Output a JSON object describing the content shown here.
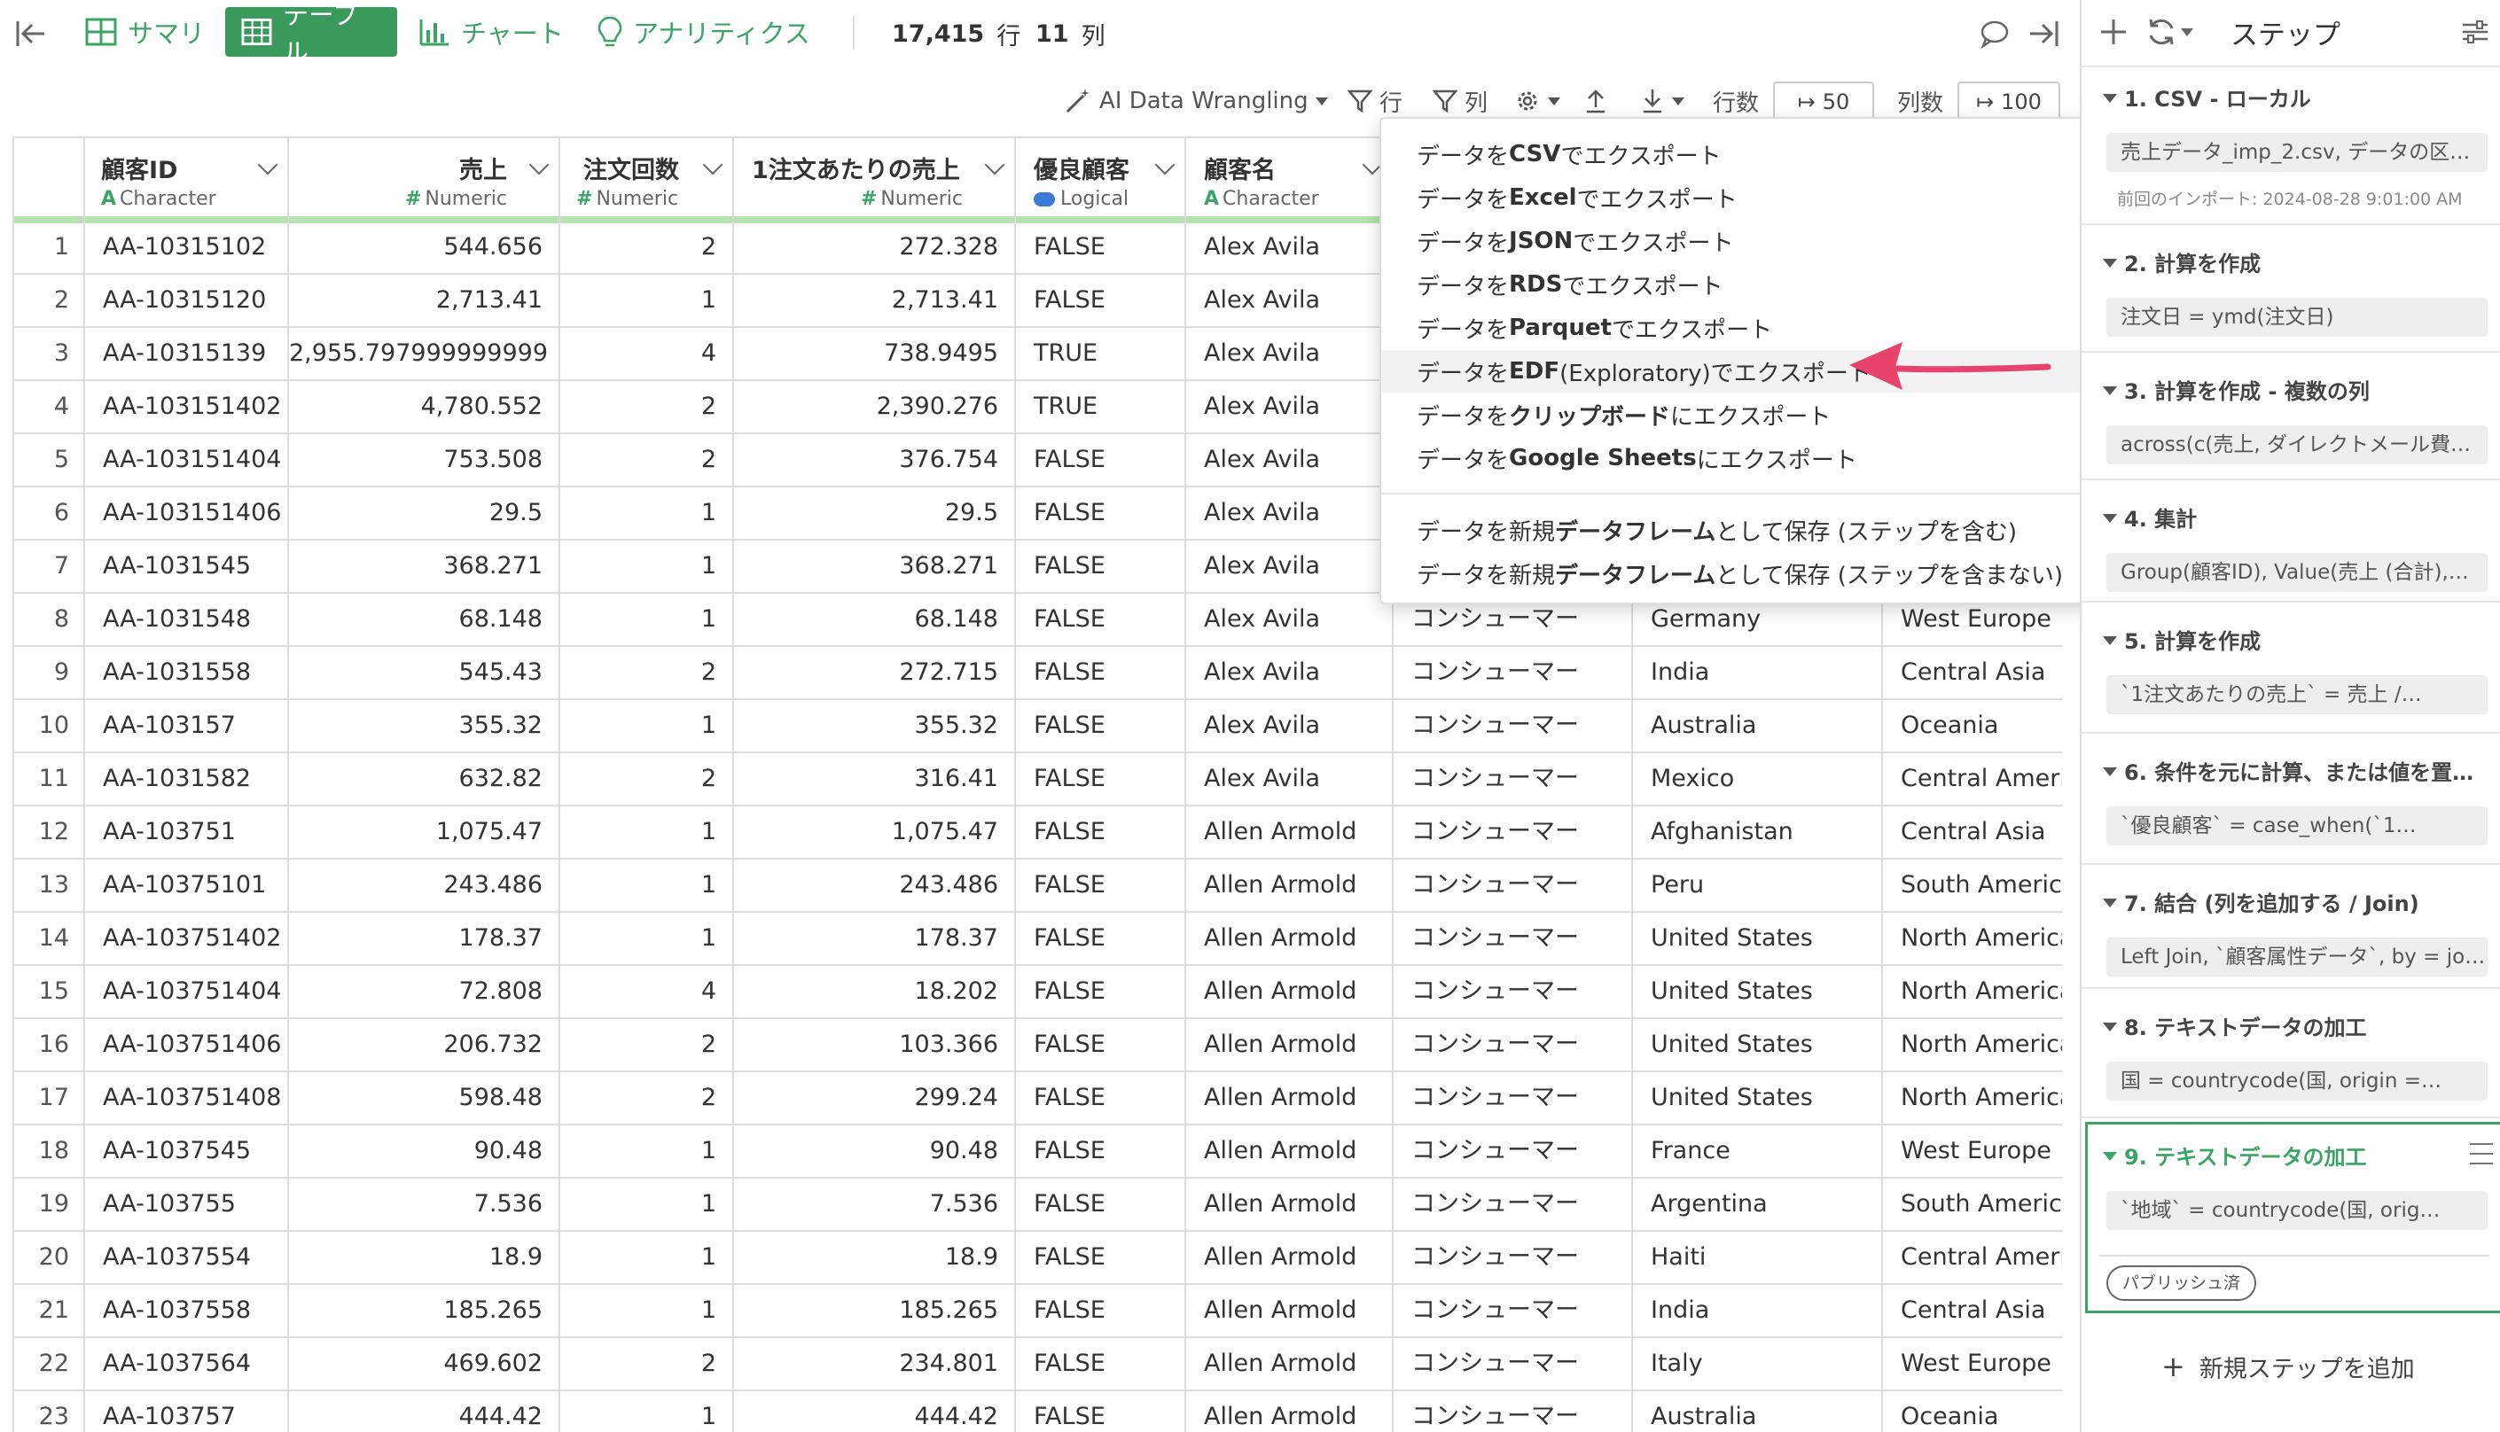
{
  "topbar": {
    "tabs": [
      {
        "label": "サマリ",
        "icon": "summary-grid-icon"
      },
      {
        "label": "テーブル",
        "icon": "table-icon"
      },
      {
        "label": "チャート",
        "icon": "bar-chart-icon"
      },
      {
        "label": "アナリティクス",
        "icon": "bulb-icon"
      }
    ],
    "rows_count": "17,415",
    "rows_unit": "行",
    "cols_count": "11",
    "cols_unit": "列"
  },
  "toolbar": {
    "ai_label": "AI Data Wrangling",
    "filter_rows": "行",
    "filter_cols": "列",
    "rows_label": "行数",
    "rows_value": "50",
    "cols_label": "列数",
    "cols_value": "100"
  },
  "colors": {
    "accent": "#3a9a5c",
    "header_underline": "#b7e3b0",
    "arrow": "#e8436a",
    "step_active_border": "#3aa565"
  },
  "columns": [
    {
      "name": "顧客ID",
      "type": "Character",
      "type_icon": "A"
    },
    {
      "name": "売上",
      "type": "Numeric",
      "type_icon": "#"
    },
    {
      "name": "注文回数",
      "type": "Numeric",
      "type_icon": "#"
    },
    {
      "name": "1注文あたりの売上",
      "type": "Numeric",
      "type_icon": "#"
    },
    {
      "name": "優良顧客",
      "type": "Logical",
      "type_icon": "toggle"
    },
    {
      "name": "顧客名",
      "type": "Character",
      "type_icon": "A"
    }
  ],
  "rows": [
    [
      "1",
      "AA-10315102",
      "544.656",
      "2",
      "272.328",
      "FALSE",
      "Alex Avila",
      "",
      ""
    ],
    [
      "2",
      "AA-10315120",
      "2,713.41",
      "1",
      "2,713.41",
      "FALSE",
      "Alex Avila",
      "",
      ""
    ],
    [
      "3",
      "AA-10315139",
      "2,955.797999999999",
      "4",
      "738.9495",
      "TRUE",
      "Alex Avila",
      "",
      ""
    ],
    [
      "4",
      "AA-103151402",
      "4,780.552",
      "2",
      "2,390.276",
      "TRUE",
      "Alex Avila",
      "",
      ""
    ],
    [
      "5",
      "AA-103151404",
      "753.508",
      "2",
      "376.754",
      "FALSE",
      "Alex Avila",
      "",
      ""
    ],
    [
      "6",
      "AA-103151406",
      "29.5",
      "1",
      "29.5",
      "FALSE",
      "Alex Avila",
      "",
      ""
    ],
    [
      "7",
      "AA-1031545",
      "368.271",
      "1",
      "368.271",
      "FALSE",
      "Alex Avila",
      "",
      ""
    ],
    [
      "8",
      "AA-1031548",
      "68.148",
      "1",
      "68.148",
      "FALSE",
      "Alex Avila",
      "コンシューマー",
      "Germany",
      "West Europe"
    ],
    [
      "9",
      "AA-1031558",
      "545.43",
      "2",
      "272.715",
      "FALSE",
      "Alex Avila",
      "コンシューマー",
      "India",
      "Central Asia"
    ],
    [
      "10",
      "AA-103157",
      "355.32",
      "1",
      "355.32",
      "FALSE",
      "Alex Avila",
      "コンシューマー",
      "Australia",
      "Oceania"
    ],
    [
      "11",
      "AA-1031582",
      "632.82",
      "2",
      "316.41",
      "FALSE",
      "Alex Avila",
      "コンシューマー",
      "Mexico",
      "Central Americ"
    ],
    [
      "12",
      "AA-103751",
      "1,075.47",
      "1",
      "1,075.47",
      "FALSE",
      "Allen Armold",
      "コンシューマー",
      "Afghanistan",
      "Central Asia"
    ],
    [
      "13",
      "AA-10375101",
      "243.486",
      "1",
      "243.486",
      "FALSE",
      "Allen Armold",
      "コンシューマー",
      "Peru",
      "South America"
    ],
    [
      "14",
      "AA-103751402",
      "178.37",
      "1",
      "178.37",
      "FALSE",
      "Allen Armold",
      "コンシューマー",
      "United States",
      "North America"
    ],
    [
      "15",
      "AA-103751404",
      "72.808",
      "4",
      "18.202",
      "FALSE",
      "Allen Armold",
      "コンシューマー",
      "United States",
      "North America"
    ],
    [
      "16",
      "AA-103751406",
      "206.732",
      "2",
      "103.366",
      "FALSE",
      "Allen Armold",
      "コンシューマー",
      "United States",
      "North America"
    ],
    [
      "17",
      "AA-103751408",
      "598.48",
      "2",
      "299.24",
      "FALSE",
      "Allen Armold",
      "コンシューマー",
      "United States",
      "North America"
    ],
    [
      "18",
      "AA-1037545",
      "90.48",
      "1",
      "90.48",
      "FALSE",
      "Allen Armold",
      "コンシューマー",
      "France",
      "West Europe"
    ],
    [
      "19",
      "AA-103755",
      "7.536",
      "1",
      "7.536",
      "FALSE",
      "Allen Armold",
      "コンシューマー",
      "Argentina",
      "South America"
    ],
    [
      "20",
      "AA-1037554",
      "18.9",
      "1",
      "18.9",
      "FALSE",
      "Allen Armold",
      "コンシューマー",
      "Haiti",
      "Central Americ"
    ],
    [
      "21",
      "AA-1037558",
      "185.265",
      "1",
      "185.265",
      "FALSE",
      "Allen Armold",
      "コンシューマー",
      "India",
      "Central Asia"
    ],
    [
      "22",
      "AA-1037564",
      "469.602",
      "2",
      "234.801",
      "FALSE",
      "Allen Armold",
      "コンシューマー",
      "Italy",
      "West Europe"
    ],
    [
      "23",
      "AA-103757",
      "444.42",
      "1",
      "444.42",
      "FALSE",
      "Allen Armold",
      "コンシューマー",
      "Australia",
      "Oceania"
    ]
  ],
  "menu": {
    "items": [
      {
        "pre": "データを",
        "bold": "CSV",
        "post": "でエクスポート"
      },
      {
        "pre": "データを",
        "bold": "Excel",
        "post": "でエクスポート"
      },
      {
        "pre": "データを",
        "bold": "JSON",
        "post": "でエクスポート"
      },
      {
        "pre": "データを",
        "bold": "RDS",
        "post": "でエクスポート"
      },
      {
        "pre": "データを",
        "bold": "Parquet",
        "post": "でエクスポート"
      },
      {
        "pre": "データを",
        "bold": "EDF",
        "post": " (Exploratory)でエクスポート"
      },
      {
        "pre": "データを",
        "bold": "クリップボード",
        "post": "にエクスポート"
      },
      {
        "pre": "データを",
        "bold": "Google Sheets",
        "post": "にエクスポート"
      }
    ],
    "save_items": [
      {
        "pre": "データを新規",
        "bold": "データフレーム",
        "post": "として保存 (ステップを含む)"
      },
      {
        "pre": "データを新規",
        "bold": "データフレーム",
        "post": "として保存 (ステップを含まない)"
      }
    ]
  },
  "panel": {
    "title": "ステップ",
    "steps": [
      {
        "title": "1. CSV - ローカル",
        "box": "売上データ_imp_2.csv, データの区…",
        "note": "前回のインポート: 2024-08-28 9:01:00 AM"
      },
      {
        "title": "2. 計算を作成",
        "box": "注文日 = ymd(注文日)"
      },
      {
        "title": "3. 計算を作成 - 複数の列",
        "box": "across(c(売上, ダイレクトメール費…"
      },
      {
        "title": "4. 集計",
        "box": "Group(顧客ID), Value(売上 (合計),注…"
      },
      {
        "title": "5. 計算を作成",
        "box": "`1注文あたりの売上` = 売上 /…"
      },
      {
        "title": "6. 条件を元に計算、または値を置…",
        "box": "`優良顧客` = case_when(`1…"
      },
      {
        "title": "7. 結合 (列を追加する / Join)",
        "box": "Left Join, `顧客属性データ`, by = joi…"
      },
      {
        "title": "8. テキストデータの加工",
        "box": "国 = countrycode(国, origin =…"
      },
      {
        "title": "9. テキストデータの加工",
        "box": "`地域` = countrycode(国, orig…",
        "badge": "パブリッシュ済"
      }
    ],
    "add_step": "新規ステップを追加"
  }
}
